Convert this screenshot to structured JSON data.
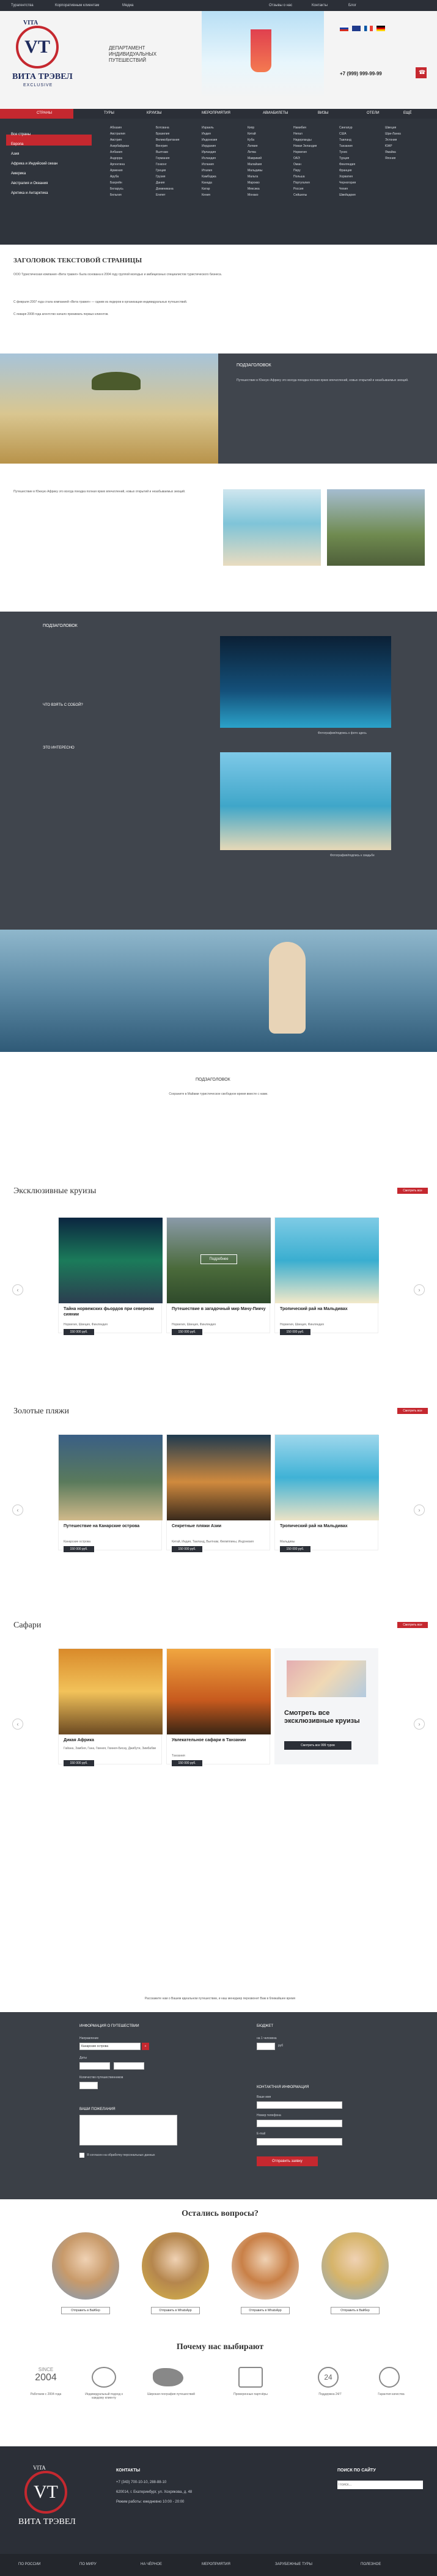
{
  "topbar": {
    "left_links": [
      "Турагентства",
      "Корпоративным клиентам",
      "Медиа"
    ],
    "right_links": [
      "Отзывы о нас",
      "Контакты",
      "Блог"
    ]
  },
  "header": {
    "tagline": "ДЕПАРТАМЕНТ ИНДИВИДУАЛЬНЫХ ПУТЕШЕСТВИЙ",
    "phone": "+7 (999) 999-99-99",
    "logo_text_top": "VITA",
    "logo_text_mid": "VT",
    "logo_text_bottom": "ВИТА ТРЭВЕЛ",
    "logo_text_foot": "EXCLUSIVE"
  },
  "nav": {
    "items": [
      "СТРАНЫ",
      "ТУРЫ",
      "КРУИЗЫ",
      "МЕРОПРИЯТИЯ",
      "АВИАБИЛЕТЫ",
      "ВИЗЫ",
      "ОТЕЛИ",
      "ТУРАГЕНТСТВА",
      "ЕЩЁ"
    ]
  },
  "mega": {
    "left_menu": [
      "Все страны",
      "Европа",
      "Азия",
      "Африка и Индийский океан",
      "Америка",
      "Австралия и Океания",
      "Арктика и Антарктика"
    ],
    "columns": [
      [
        "Абхазия",
        "Австралия",
        "Австрия",
        "Азербайджан",
        "Албания",
        "Андорра",
        "Аргентина",
        "Армения",
        "Аруба",
        "Бахрейн",
        "Беларусь",
        "Бельгия"
      ],
      [
        "Ботсвана",
        "Бразилия",
        "Великобритания",
        "Венгрия",
        "Вьетнам",
        "Германия",
        "Гонконг",
        "Греция",
        "Грузия",
        "Дания",
        "Доминикана",
        "Египет"
      ],
      [
        "Израиль",
        "Индия",
        "Индонезия",
        "Иордания",
        "Ирландия",
        "Исландия",
        "Испания",
        "Италия",
        "Камбоджа",
        "Канада",
        "Катар",
        "Кения"
      ],
      [
        "Кипр",
        "Китай",
        "Куба",
        "Латвия",
        "Литва",
        "Маврикий",
        "Малайзия",
        "Мальдивы",
        "Мальта",
        "Марокко",
        "Мексика",
        "Монако"
      ],
      [
        "Намибия",
        "Непал",
        "Нидерланды",
        "Новая Зеландия",
        "Норвегия",
        "ОАЭ",
        "Оман",
        "Перу",
        "Польша",
        "Португалия",
        "Россия",
        "Сейшелы"
      ],
      [
        "Сингапур",
        "США",
        "Таиланд",
        "Танзания",
        "Тунис",
        "Турция",
        "Финляндия",
        "Франция",
        "Хорватия",
        "Черногория",
        "Чехия",
        "Швейцария"
      ],
      [
        "Швеция",
        "Шри-Ланка",
        "Эстония",
        "ЮАР",
        "Ямайка",
        "Япония"
      ]
    ]
  },
  "page": {
    "title": "ЗАГОЛОВОК ТЕКСТОВОЙ СТРАНИЦЫ",
    "intro_1": "ООО Туристическая компания «Вита травел» была основана в 2004 году группой молодых и амбициозных специалистов туристического бизнеса.",
    "intro_2": "С февраля 2007 года стала компанией «Вита травел» — одним из лидеров в организации индивидуальных путешествий.",
    "intro_3": "С января 2008 года агентство начало принимать первых клиентов.",
    "subheading_1": "ПОДЗАГОЛОВОК",
    "subheading_2": "ПОДЗАГОЛОВОК",
    "subheading_3": "ПОДЗАГОЛОВОК",
    "caption_1": "Фотография/подпись к фото здесь",
    "caption_2": "Фотография/подпись к свадьбе",
    "para_dark": "Путешествие в Южную Африку это всегда поездка полная ярких впечатлений, новых открытий и незабываемых эмоций.",
    "list_heading_1": "ЧТО ВЗЯТЬ С СОБОЙ?",
    "list_heading_2": "ЭТО ИНТЕРЕСНО",
    "footer_para": "Сохраните в Майами туристическое свободное время вместе с нами."
  },
  "sections": [
    {
      "title": "Эксклюзивные круизы",
      "all_label": "Смотреть все",
      "cards": [
        {
          "title": "Тайна норвежских фьордов при северном сиянии",
          "meta": "Норвегия, Швеция, Финляндия",
          "price": "150 000 руб."
        },
        {
          "title": "Путешествие в загадочный мир Мачу-Пикчу",
          "meta": "Норвегия, Швеция, Финляндия",
          "price": "150 000 руб."
        },
        {
          "title": "Тропический рай на Мальдивах",
          "meta": "Норвегия, Швеция, Финляндия",
          "price": "150 000 руб."
        }
      ],
      "badge": "Подробнее"
    },
    {
      "title": "Золотые пляжи",
      "all_label": "Смотреть все",
      "cards": [
        {
          "title": "Путешествие на Канарские острова",
          "meta": "Канарские острова",
          "price": "150 000 руб."
        },
        {
          "title": "Секретные пляжи Азии",
          "meta": "Китай, Индия, Таиланд, Вьетнам, Филиппины, Индонезия",
          "price": "150 000 руб."
        },
        {
          "title": "Тропический рай на Мальдивах",
          "meta": "Мальдивы",
          "price": "150 000 руб."
        }
      ]
    },
    {
      "title": "Сафари",
      "all_label": "Смотреть все",
      "cards": [
        {
          "title": "Дикая Африка",
          "meta": "Гайана, Замбия, Гана, Гвинея, Гвинея-Бисау, Джибути, Зимбабве",
          "price": "150 000 руб."
        },
        {
          "title": "Увлекательное сафари в Танзании",
          "meta": "Танзания",
          "price": "150 000 руб."
        }
      ],
      "promo_title": "Смотреть все эксклюзивные круизы",
      "promo_button": "Смотреть все 999 туров"
    }
  ],
  "form": {
    "note": "Расскажите нам о Вашем идеальном путешествии, и наш менеджер перезвонит Вам в ближайшее время",
    "title_left": "ИНФОРМАЦИЯ О ПУТЕШЕСТВИИ",
    "title_right": "БЮДЖЕТ",
    "where_label": "Направление",
    "where_value": "Канарские острова",
    "add_label": "+",
    "dates_label": "Даты",
    "budget_label": "на 1 человека",
    "currency_label": "руб",
    "people_label": "Количество путешественников",
    "contact_title": "КОНТАКТНАЯ ИНФОРМАЦИЯ",
    "name_label": "Ваше имя",
    "phone_label": "Номер телефона",
    "email_label": "E-mail",
    "wishes_title": "ВАШИ ПОЖЕЛАНИЯ",
    "checkbox_label": "Я согласен на обработку персональных данных",
    "submit": "Отправить заявку"
  },
  "contacts": {
    "title": "Остались вопросы?",
    "people": [
      {
        "button": "Отправить в Вайбер"
      },
      {
        "button": "Отправить в WhatsApp"
      },
      {
        "button": "Отправить в WhatsApp"
      },
      {
        "button": "Отправить в Вайбер"
      }
    ]
  },
  "why": {
    "title": "Почему нас выбирают",
    "since_label": "SINCE",
    "since_year": "2004",
    "items": [
      "Работаем с 2004 года",
      "Индивидуальный подход к каждому клиенту",
      "Широкая география путешествий",
      "Проверенные партнёры",
      "Поддержка 24/7",
      "Гарантия качества"
    ],
    "badge_24": "24"
  },
  "footer": {
    "contacts_title": "КОНТАКТЫ",
    "phone": "+7 (343) 700-10-10, 288-88-10",
    "address": "620014, г. Екатеринбург, ул. Хохрякова, д. 48",
    "schedule": "Режим работы: ежедневно 10:00 - 20:00",
    "search_title": "ПОИСК ПО САЙТУ",
    "search_placeholder": "Поиск...",
    "bottom_links": [
      "ПО РОССИИ",
      "ПО МИРУ",
      "НА ЧЁРНОЕ",
      "МЕРОПРИЯТИЯ",
      "ЗАРУБЕЖНЫЕ ТУРЫ",
      "ПОЛЕЗНОЕ"
    ]
  },
  "colors": {
    "accent": "#c5282f",
    "dark": "#2b2f37",
    "grey": "#40454d"
  }
}
